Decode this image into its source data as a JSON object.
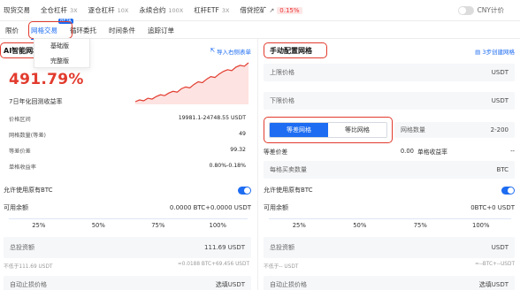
{
  "topnav": {
    "items": [
      {
        "label": "现货交易",
        "sub": ""
      },
      {
        "label": "全仓杠杆",
        "sub": "3X"
      },
      {
        "label": "逐仓杠杆",
        "sub": "10X"
      },
      {
        "label": "永续合约",
        "sub": "100X"
      },
      {
        "label": "杠杆ETF",
        "sub": "3X"
      },
      {
        "label": "借贷挖矿",
        "sub": ""
      }
    ],
    "lending_rate": "0.15%",
    "cny_label": "CNY计价"
  },
  "subnav": {
    "tabs": [
      "限价",
      "网格交易",
      "循环委托",
      "时间条件",
      "追踪订单"
    ],
    "active_tab": "网格交易",
    "beta_badge": "BETA",
    "dropdown": [
      "基础版",
      "完整版"
    ]
  },
  "ai_panel": {
    "title": "AI智能网格",
    "import_link": "导入右侧表单",
    "yield_value": "491.79%",
    "yield_label": "7日年化回测收益率",
    "details": [
      {
        "label": "价格区间",
        "value": "19981.1-24748.55 USDT"
      },
      {
        "label": "网格数量(等差)",
        "value": "49"
      },
      {
        "label": "等差价差",
        "value": "99.32"
      },
      {
        "label": "单格收益率",
        "value": "0.80%-0.18%"
      }
    ],
    "allow_btc_label": "允许使用原有BTC",
    "available_label": "可用余额",
    "available_value": "0.0000 BTC+0.0000 USDT",
    "percents": [
      "25%",
      "50%",
      "75%",
      "100%"
    ],
    "total_invest_label": "总投资额",
    "total_invest_value": "111.69 USDT",
    "min_note_left": "不低于111.69 USDT",
    "min_note_right": "≈0.0188 BTC+69.456 USDT",
    "auto_close_label": "自动止损价格",
    "auto_close_value": "选填USDT",
    "sparkline": [
      10,
      12,
      11,
      14,
      13,
      16,
      18,
      17,
      20,
      22,
      21,
      25,
      27,
      26,
      30,
      33,
      32,
      36,
      39,
      38,
      42,
      45,
      47,
      46,
      50,
      52,
      51,
      55
    ]
  },
  "manual_panel": {
    "title": "手动配置网格",
    "step_link": "3步创建网格",
    "upper_label": "上限价格",
    "upper_unit": "USDT",
    "lower_label": "下限价格",
    "lower_unit": "USDT",
    "mode_options": [
      "等差网格",
      "等比网格"
    ],
    "mode_active": "等差网格",
    "grid_count_label": "网格数量",
    "grid_count_range": "2-200",
    "price_diff_label": "等差价差",
    "price_diff_value": "0.00",
    "per_grid_yield_label": "单格收益率",
    "per_grid_yield_value": "--",
    "per_grid_buy_label": "每格买卖数量",
    "per_grid_buy_unit": "BTC",
    "allow_btc_label": "允许使用原有BTC",
    "available_label": "可用余额",
    "available_value": "0BTC+0 USDT",
    "percents": [
      "25%",
      "50%",
      "75%",
      "100%"
    ],
    "total_invest_label": "总投资额",
    "total_invest_unit": "USDT",
    "min_note_left": "不低于-- USDT",
    "min_note_right": "≈--BTC+--USDT",
    "auto_close_label": "自动止损价格",
    "auto_close_value": "选填USDT"
  }
}
